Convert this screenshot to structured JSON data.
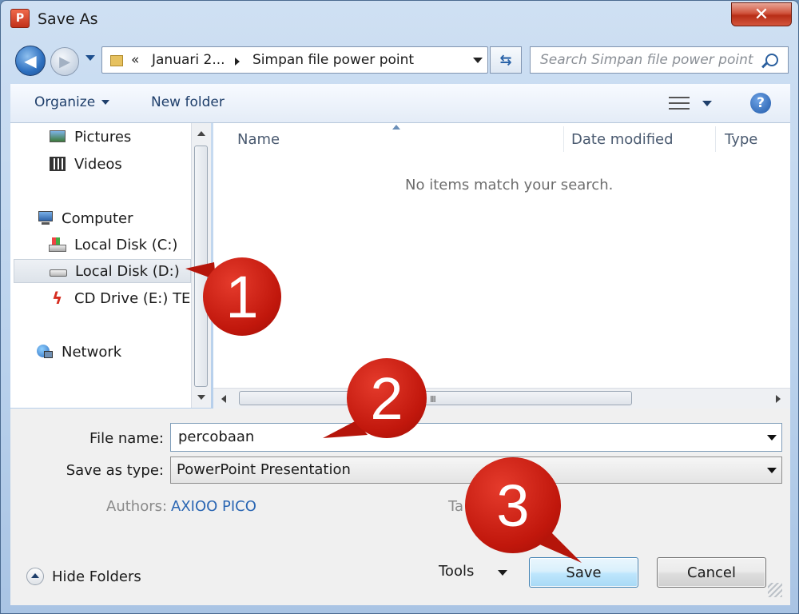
{
  "window": {
    "title": "Save As",
    "app_icon": "powerpoint-icon",
    "close_glyph": "✕"
  },
  "address": {
    "back_glyph": "◀",
    "forward_glyph": "▶",
    "overflow": "«",
    "segments": [
      "Januari 2...",
      "Simpan file power point"
    ],
    "refresh_glyph": "⇆",
    "search_placeholder": "Search Simpan file power point"
  },
  "toolbar": {
    "organize": "Organize",
    "new_folder": "New folder",
    "help_glyph": "?"
  },
  "nav": {
    "items": [
      {
        "label": "Pictures",
        "icon": "pictures-icon"
      },
      {
        "label": "Videos",
        "icon": "videos-icon"
      },
      {
        "label": "Computer",
        "icon": "computer-icon"
      },
      {
        "label": "Local Disk (C:)",
        "icon": "local-disk-c-icon"
      },
      {
        "label": "Local Disk (D:)",
        "icon": "drive-icon",
        "selected": true
      },
      {
        "label": "CD Drive (E:) TEL",
        "icon": "cd-drive-icon"
      },
      {
        "label": "Network",
        "icon": "network-icon"
      }
    ]
  },
  "files": {
    "columns": [
      "Name",
      "Date modified",
      "Type"
    ],
    "empty_message": "No items match your search.",
    "scroll_grip": "III"
  },
  "form": {
    "file_name_label": "File name:",
    "file_name_value": "percobaan",
    "save_type_label": "Save as type:",
    "save_type_value": "PowerPoint Presentation",
    "authors_label": "Authors:",
    "authors_value": "AXIOO PICO",
    "tags_label": "Ta"
  },
  "footer": {
    "hide_folders": "Hide Folders",
    "tools": "Tools",
    "save": "Save",
    "cancel": "Cancel"
  },
  "callouts": [
    "1",
    "2",
    "3"
  ],
  "colors": {
    "callout": "#c1170c",
    "link": "#2a66b3"
  }
}
